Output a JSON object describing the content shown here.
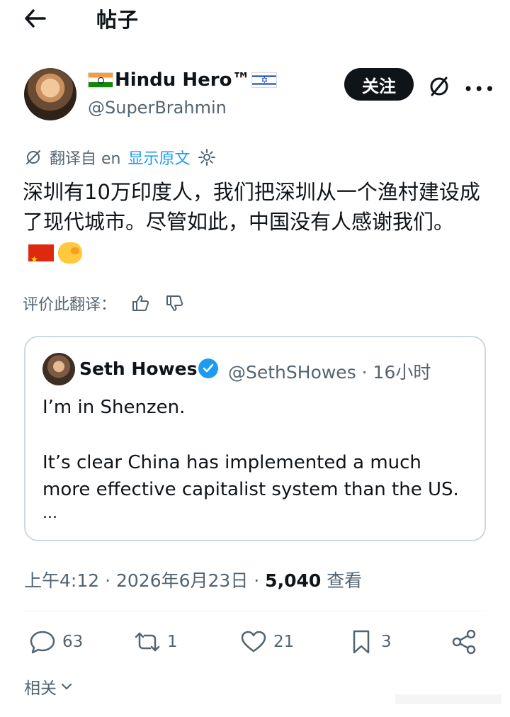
{
  "header": {
    "title": "帖子"
  },
  "post": {
    "display_name": "Hindu Hero™",
    "handle": "@SuperBrahmin",
    "follow_label": "关注",
    "translated_from": "翻译自 en",
    "show_original": "显示原文",
    "text": "深圳有10万印度人，我们把深圳从一个渔村建设成了现代城市。尽管如此，中国没有人感谢我们。",
    "rate_translation": "评价此翻译：",
    "timestamp": "上午4:12 · 2026年6月23日 · ",
    "views_count": "5,040",
    "views_label": " 查看"
  },
  "quote": {
    "name": "Seth Howes",
    "handle_time": "@SethSHowes · 16小时",
    "line1": "I’m in Shenzen.",
    "line2": "It’s clear China has implemented a much more effective capitalist system than the US.",
    "ellipsis": "..."
  },
  "actions": {
    "replies": "63",
    "reposts": "1",
    "likes": "21",
    "bookmarks": "3"
  },
  "related_label": "相关",
  "colors": {
    "text": "#0f1419",
    "muted": "#536471",
    "accent": "#1d9bf0"
  }
}
